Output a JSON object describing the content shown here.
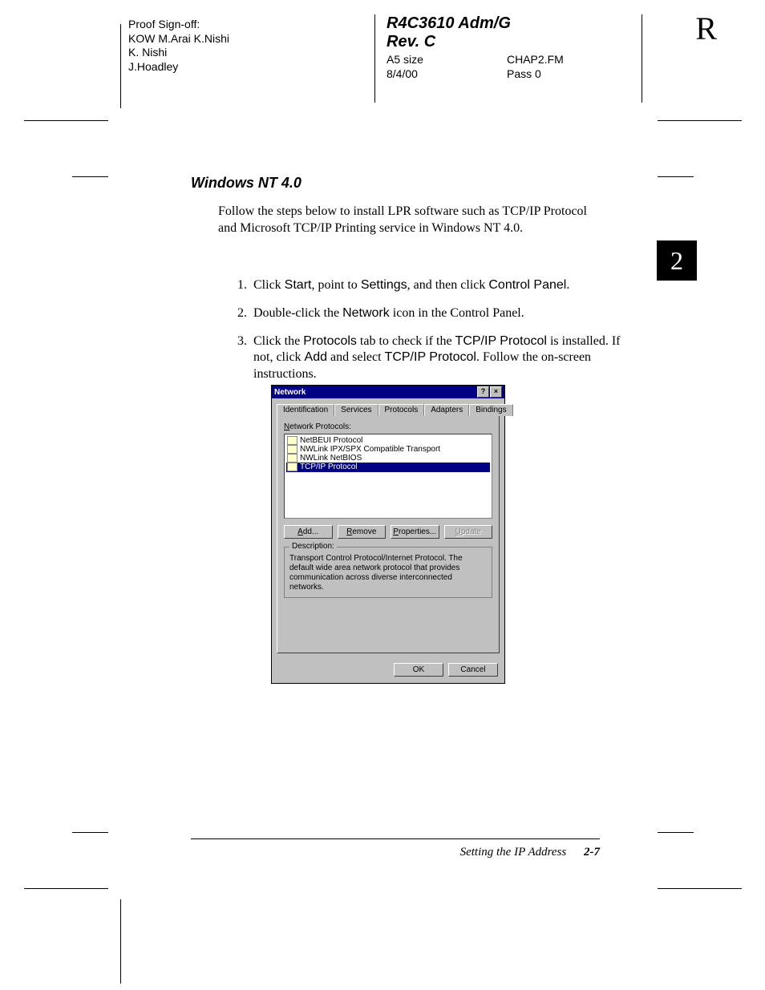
{
  "header": {
    "proof_title": "Proof Sign-off:",
    "proof_lines": [
      "KOW M.Arai  K.Nishi",
      "K. Nishi",
      "J.Hoadley"
    ],
    "doc_id": "R4C3610  Adm/G",
    "rev": "Rev. C",
    "size": "A5 size",
    "file": "CHAP2.FM",
    "date": "8/4/00",
    "pass": "Pass 0",
    "corner": "R"
  },
  "chapter_tab": "2",
  "section_title": "Windows NT 4.0",
  "intro": "Follow the steps below to install LPR software such as TCP/IP Protocol and Microsoft TCP/IP Printing service in Windows NT 4.0.",
  "steps": [
    {
      "pre": "Click ",
      "a": "Start",
      "mid1": ", point to ",
      "b": "Settings",
      "mid2": ", and then click ",
      "c": "Control Panel",
      "post": "."
    },
    {
      "pre": "Double-click the ",
      "a": "Network",
      "mid1": " icon in the Control Panel.",
      "b": "",
      "mid2": "",
      "c": "",
      "post": ""
    },
    {
      "pre": "Click the ",
      "a": "Protocols",
      "mid1": " tab to check if the ",
      "b": "TCP/IP Protocol",
      "mid2": " is installed. If not, click ",
      "c": "Add",
      "post_c": " and select ",
      "d": "TCP/IP Protocol",
      "post": ". Follow the on-screen instructions."
    }
  ],
  "dialog": {
    "title": "Network",
    "help_btn": "?",
    "close_btn": "×",
    "tabs": [
      "Identification",
      "Services",
      "Protocols",
      "Adapters",
      "Bindings"
    ],
    "active_tab": 2,
    "list_label": "Network Protocols:",
    "list_label_u": "N",
    "protocols": [
      {
        "label": "NetBEUI Protocol",
        "selected": false
      },
      {
        "label": "NWLink IPX/SPX Compatible Transport",
        "selected": false
      },
      {
        "label": "NWLink NetBIOS",
        "selected": false
      },
      {
        "label": "TCP/IP Protocol",
        "selected": true
      }
    ],
    "buttons": {
      "add": "Add...",
      "add_u": "A",
      "remove": "Remove",
      "remove_u": "R",
      "properties": "Properties...",
      "properties_u": "P",
      "update": "Update",
      "update_u": "U"
    },
    "desc_label": "Description:",
    "description": "Transport Control Protocol/Internet Protocol. The default wide area network protocol that provides communication across diverse interconnected networks.",
    "ok": "OK",
    "cancel": "Cancel"
  },
  "footer": {
    "chapter": "Setting the IP Address",
    "page": "2-7"
  }
}
